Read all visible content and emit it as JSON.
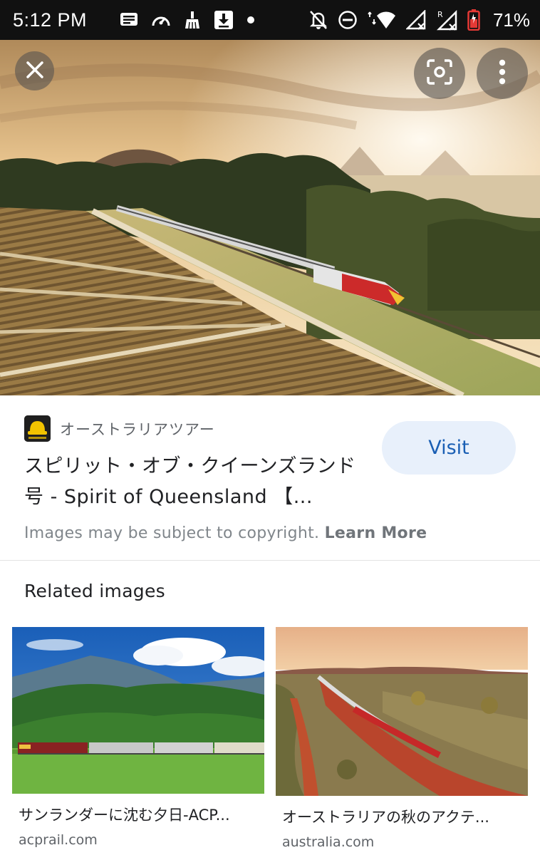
{
  "status_bar": {
    "time": "5:12 PM",
    "battery_percent": "71%",
    "icons_left": [
      "message-icon",
      "speedometer-icon",
      "broom-icon",
      "download-icon",
      "dot-icon"
    ],
    "icons_right": [
      "bell-off-icon",
      "do-not-disturb-icon",
      "wifi-icon",
      "signal-icon",
      "signal-roaming-icon",
      "battery-icon"
    ]
  },
  "viewer": {
    "close_icon": "close-icon",
    "lens_icon": "lens-icon",
    "more_icon": "more-vert-icon"
  },
  "result": {
    "source_name": "オーストラリアツアー",
    "title": "スピリット・オブ・クイーンズランド号 - Spirit of Queensland 【...",
    "visit_label": "Visit",
    "copyright_text": "Images may be subject to copyright.",
    "learn_more_label": "Learn More"
  },
  "related": {
    "heading": "Related images",
    "items": [
      {
        "title": "サンランダーに沈む夕日-ACP...",
        "domain": "acprail.com"
      },
      {
        "title": "オーストラリアの秋のアクテ...",
        "domain": "australia.com"
      }
    ]
  },
  "colors": {
    "status_bar_bg": "#111111",
    "visit_bg": "#e8f0fb",
    "visit_text": "#1a5fb4",
    "battery_low": "#e53935"
  }
}
